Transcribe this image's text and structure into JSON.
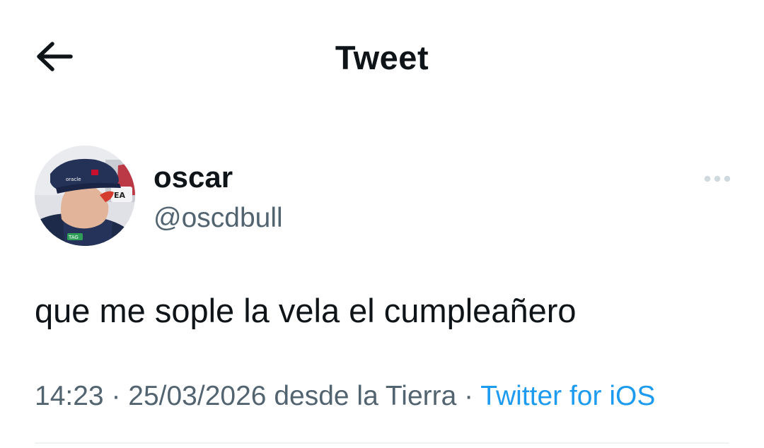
{
  "header": {
    "title": "Tweet",
    "back_icon": "arrow-left-icon"
  },
  "tweet": {
    "author": {
      "display_name": "oscar",
      "handle": "@oscdbull",
      "avatar_icon": "profile-photo"
    },
    "more_icon": "more-horizontal-icon",
    "text": "que me sople la vela el cumpleañero",
    "meta": {
      "time": "14:23",
      "separator": " · ",
      "date": "25/03/2026",
      "location": "desde la Tierra",
      "source": "Twitter for iOS"
    }
  },
  "colors": {
    "text_primary": "#0f1419",
    "text_secondary": "#536471",
    "link": "#1d9bf0",
    "divider": "#eff3f4"
  }
}
